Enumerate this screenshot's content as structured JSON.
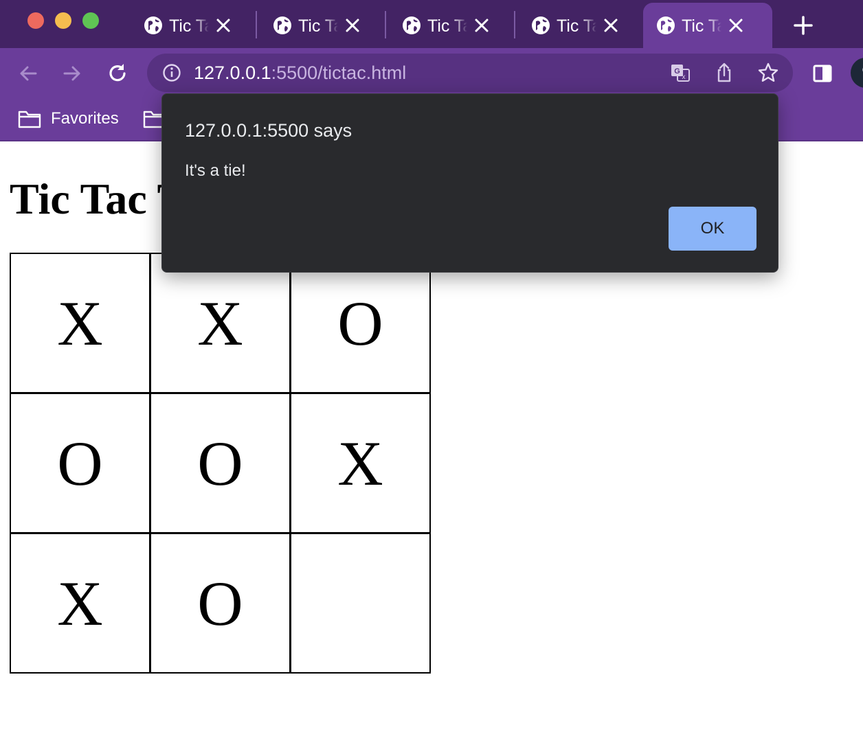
{
  "browser": {
    "tabs": [
      {
        "title": "Tic Tac Toe",
        "active": false
      },
      {
        "title": "Tic Tac Toe",
        "active": false
      },
      {
        "title": "Tic Tac Toe",
        "active": false
      },
      {
        "title": "Tic Tac Toe",
        "active": false
      },
      {
        "title": "Tic Tac Toe",
        "active": true
      }
    ],
    "address_bar": {
      "host": "127.0.0.1",
      "rest": ":5500/tictac.html"
    },
    "bookmarks": [
      {
        "label": "Favorites"
      }
    ],
    "colors": {
      "tabstrip": "#432364",
      "toolbar": "#6a3d9a",
      "omnibox": "#573181"
    },
    "icons": [
      "globe-icon",
      "close-icon",
      "plus-icon",
      "back-arrow-icon",
      "forward-arrow-icon",
      "reload-icon",
      "info-icon",
      "translate-icon",
      "share-icon",
      "star-icon",
      "side-panel-icon",
      "folder-icon"
    ]
  },
  "page": {
    "title": "Tic Tac Toe",
    "board": [
      "X",
      "X",
      "O",
      "O",
      "O",
      "X",
      "X",
      "O",
      ""
    ]
  },
  "dialog": {
    "title": "127.0.0.1:5500 says",
    "message": "It's a tie!",
    "ok_label": "OK",
    "colors": {
      "background": "#292a2d",
      "button": "#8ab4f8"
    }
  }
}
